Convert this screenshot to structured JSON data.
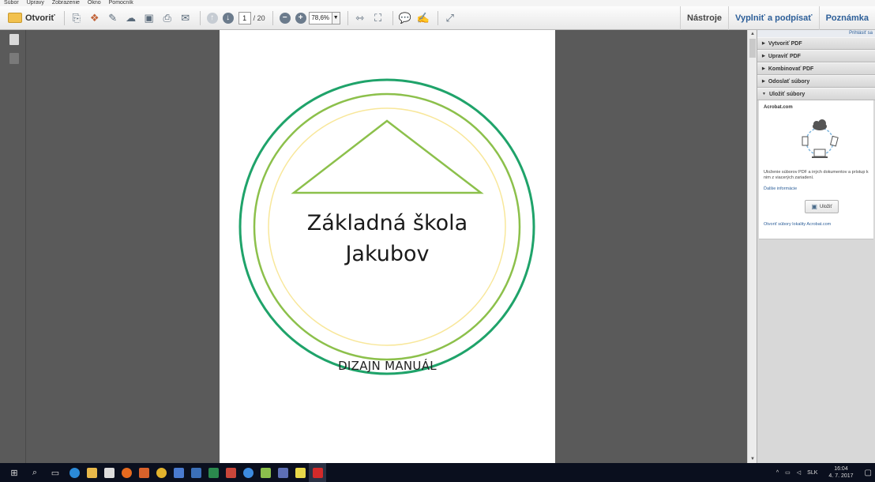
{
  "menubar": {
    "items": [
      "Súbor",
      "Úpravy",
      "Zobrazenie",
      "Okno",
      "Pomocník"
    ]
  },
  "toolbar": {
    "open_label": "Otvoriť",
    "page_current": "1",
    "page_total": "/ 20",
    "zoom": "78,6%",
    "right_tabs": [
      "Nástroje",
      "Vyplniť a podpísať",
      "Poznámka"
    ]
  },
  "document": {
    "school_line1": "Základná škola",
    "school_line2": "Jakubov",
    "manual_title": "DIZAJN MANUÁL",
    "colors": {
      "outer_ring": "#1fa36a",
      "middle_ring": "#8cc04b",
      "inner_ring": "#f8e79a",
      "triangle": "#8cc04b"
    }
  },
  "rightpanel": {
    "sign_in": "Prihlásiť sa",
    "sections": [
      {
        "label": "Vytvoriť PDF",
        "expanded": false
      },
      {
        "label": "Upraviť PDF",
        "expanded": false
      },
      {
        "label": "Kombinovať PDF",
        "expanded": false
      },
      {
        "label": "Odoslať súbory",
        "expanded": false
      },
      {
        "label": "Uložiť súbory",
        "expanded": true
      }
    ],
    "acrobat": {
      "title": "Acrobat.com",
      "description": "Uloženie súborov PDF a iných dokumentov a prístup k nim z viacerých zariadení.",
      "more_info": "Ďalšie informácie",
      "save_label": "Uložiť",
      "open_link": "Otvoriť súbory lokality Acrobat.com"
    }
  },
  "taskbar": {
    "language": "SLK",
    "time": "16:04",
    "date": "4. 7. 2017"
  }
}
